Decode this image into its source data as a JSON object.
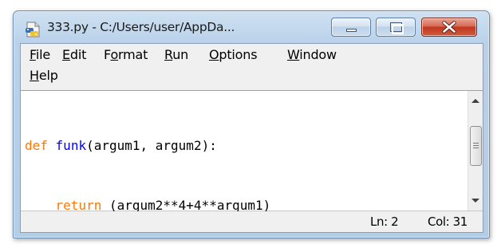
{
  "window": {
    "title": "333.py - C:/Users/user/AppDa..."
  },
  "menu": [
    {
      "pre": "",
      "key": "F",
      "post": "ile"
    },
    {
      "pre": "",
      "key": "E",
      "post": "dit"
    },
    {
      "pre": "F",
      "key": "o",
      "post": "rmat"
    },
    {
      "pre": "",
      "key": "R",
      "post": "un"
    },
    {
      "pre": "",
      "key": "O",
      "post": "ptions"
    },
    {
      "pre": "",
      "key": "W",
      "post": "indow"
    },
    {
      "pre": "",
      "key": "H",
      "post": "elp"
    }
  ],
  "editor": {
    "line1": {
      "kw": "def",
      "fn": "funk",
      "rest": "(argum1, argum2):"
    },
    "line2": {
      "indent": "    ",
      "kw": "return",
      "rest": " (argum2**4+4**argum1)"
    }
  },
  "status": {
    "line": "Ln: 2",
    "col": "Col: 31"
  },
  "colors": {
    "keyword": "#ff7700",
    "function_name": "#0000ff",
    "close_button": "#c0391f"
  },
  "icons": [
    "python-file-icon",
    "minimize-icon",
    "maximize-icon",
    "close-icon",
    "scroll-up-icon",
    "scroll-down-icon"
  ]
}
